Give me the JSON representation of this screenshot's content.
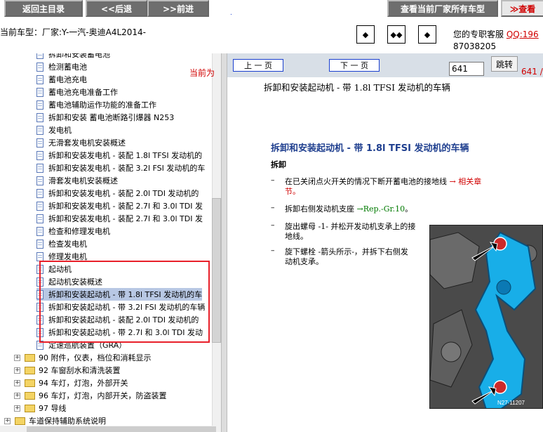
{
  "toolbar": {
    "home_label": "返回主目录",
    "back_label": "<<后退",
    "forward_label": ">>前进",
    "all_models_label": "查看当前厂家所有车型",
    "check_label": "≫查看",
    "dot_text": "."
  },
  "info": {
    "model_text": "当前车型：厂家:Y-一汽-奥迪A4L2014-",
    "service_label": "您的专职客服",
    "qq_text": "QQ:196",
    "phone_text": "87038205"
  },
  "tree": {
    "items": [
      {
        "text": "拆卸和安装蓄电池"
      },
      {
        "text": "检测蓄电池"
      },
      {
        "text": "蓄电池充电"
      },
      {
        "text": "蓄电池充电准备工作"
      },
      {
        "text": "蓄电池辅助运作功能的准备工作"
      },
      {
        "text": "拆卸和安装 蓄电池断路引爆器 N253"
      },
      {
        "text": "发电机"
      },
      {
        "text": "无滑套发电机安装概述"
      },
      {
        "text": "拆卸和安装发电机 - 装配 1.8l TFSI 发动机的"
      },
      {
        "text": "拆卸和安装发电机 - 装配 3.2l FSI 发动机的车"
      },
      {
        "text": "滑套发电机安装概述"
      },
      {
        "text": "拆卸和安装发电机 - 装配 2.0l TDI 发动机的"
      },
      {
        "text": "拆卸和安装发电机 - 装配 2.7l 和 3.0l TDI 发"
      },
      {
        "text": "拆卸和安装发电机 - 装配 2.7l 和 3.0l TDI 发"
      },
      {
        "text": "检查和修理发电机"
      },
      {
        "text": "检查发电机"
      },
      {
        "text": "修理发电机"
      },
      {
        "text": "起动机"
      },
      {
        "text": "起动机安装概述"
      },
      {
        "text": "拆卸和安装起动机 - 带 1.8l TFSI 发动机的车"
      },
      {
        "text": "拆卸和安装起动机 - 带 3.2l FSI 发动机的车辆"
      },
      {
        "text": "拆卸和安装起动机 - 装配 2.0l TDI 发动机的"
      },
      {
        "text": "拆卸和安装起动机 - 带 2.7l 和 3.0l TDI 发动"
      },
      {
        "text": "定速巡航装置（GRA）"
      }
    ],
    "folders": [
      {
        "text": "90 附件，仪表，档位和消耗显示"
      },
      {
        "text": "92 车窗刮水和清洗装置"
      },
      {
        "text": "94 车灯，灯泡，外部开关"
      },
      {
        "text": "96 车灯，灯泡，内部开关，防盗装置"
      },
      {
        "text": "97 导线"
      },
      {
        "text": "车道保持辅助系统说明"
      }
    ]
  },
  "pager": {
    "prev_label": "上 一 页",
    "next_label": "下 一 页",
    "current_label": "当前为",
    "current_value": "641",
    "go_label": "跳转",
    "total_text": "641 /"
  },
  "doc": {
    "title": "拆卸和安装起动机 - 带 1.8l TFSI 发动机的车辆",
    "heading": "拆卸和安装起动机 - 带 1.8l TFSI 发动机的车辆",
    "section": "拆卸",
    "step1_a": "在已关闭点火开关的情况下断开蓄电池的接地线",
    "step1_link": "→ 相关章",
    "step1_b": "节。",
    "step2_a": "拆卸右侧发动机支座",
    "step2_link": "→Rep.-Gr.10",
    "step2_b": "。",
    "step3_a": "旋出螺母 -1- 并松开发动机支承上的接",
    "step3_b": "地线。",
    "step4_a": "旋下螺栓 -箭头所示-，并拆下右侧发",
    "step4_b": "动机支承。",
    "image_code": "N27-11207"
  },
  "colors": {
    "toolbar_button": "#6e6e6e",
    "link_red": "#d00000",
    "link_green": "#007a00",
    "heading_blue": "#1f3f8f",
    "selection": "#b8c8e4",
    "highlight_box": "#e8202a",
    "pager_bar": "#d8dfe7"
  }
}
